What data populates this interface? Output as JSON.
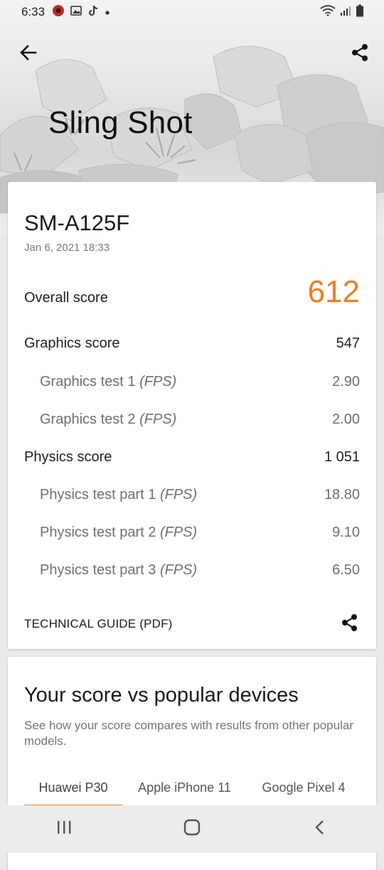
{
  "status_bar": {
    "time": "6:33",
    "left_icons": [
      "app-notification-icon",
      "gallery-icon",
      "tiktok-icon",
      "dot-icon"
    ],
    "right_icons": [
      "wifi-icon",
      "signal-icon",
      "battery-icon"
    ]
  },
  "header": {
    "title": "Sling Shot",
    "back_icon": "arrow-left-icon",
    "share_icon": "share-icon"
  },
  "result": {
    "device": "SM-A125F",
    "date": "Jan 6, 2021 18:33",
    "overall": {
      "label": "Overall score",
      "value": "612"
    },
    "graphics": {
      "label": "Graphics score",
      "value": "547"
    },
    "graphics_tests": [
      {
        "label": "Graphics test 1",
        "unit": "(FPS)",
        "value": "2.90"
      },
      {
        "label": "Graphics test 2",
        "unit": "(FPS)",
        "value": "2.00"
      }
    ],
    "physics": {
      "label": "Physics score",
      "value": "1 051"
    },
    "physics_tests": [
      {
        "label": "Physics test part 1",
        "unit": "(FPS)",
        "value": "18.80"
      },
      {
        "label": "Physics test part 2",
        "unit": "(FPS)",
        "value": "9.10"
      },
      {
        "label": "Physics test part 3",
        "unit": "(FPS)",
        "value": "6.50"
      }
    ],
    "technical_guide": "TECHNICAL GUIDE (PDF)"
  },
  "compare": {
    "title": "Your score vs popular devices",
    "description": "See how your score compares with results from other popular models.",
    "tabs": [
      {
        "label": "Huawei P30",
        "active": true
      },
      {
        "label": "Apple iPhone 11",
        "active": false
      },
      {
        "label": "Google Pixel 4",
        "active": false
      }
    ]
  },
  "nav_bar": {
    "icons": [
      "recents-icon",
      "home-icon",
      "back-icon"
    ]
  },
  "colors": {
    "accent": "#ef7d22",
    "card": "#ffffff",
    "text": "#1c1c1c",
    "muted": "#6f6f6f"
  }
}
